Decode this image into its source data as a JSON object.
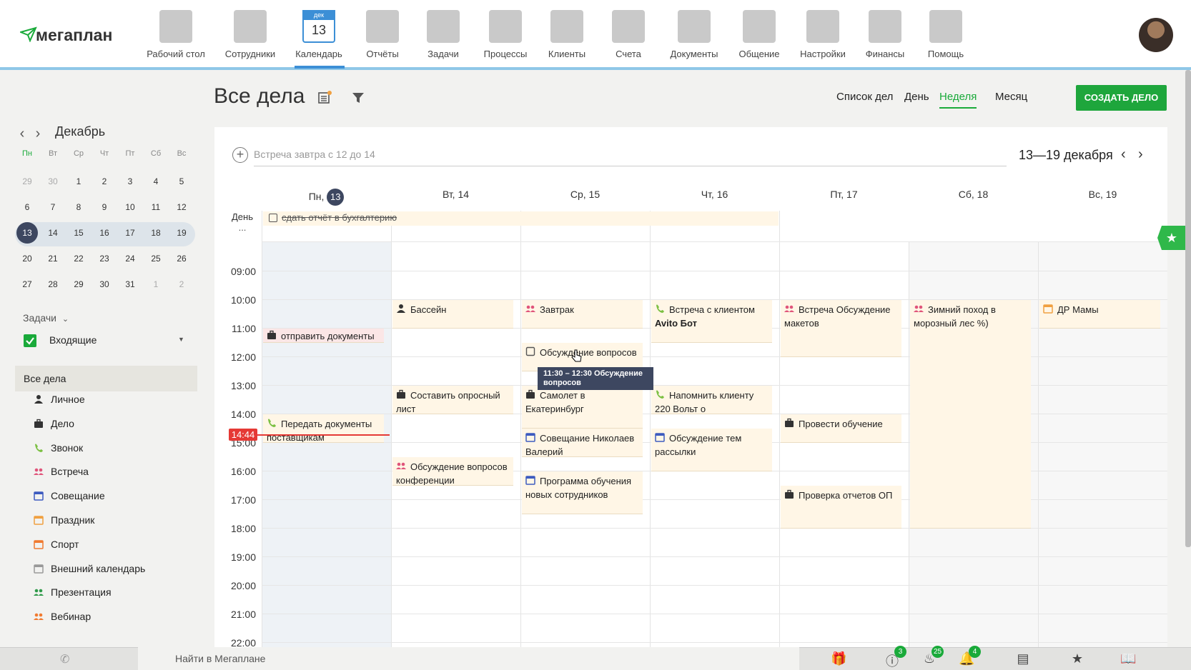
{
  "app": {
    "logo": "мегаплан"
  },
  "nav": [
    {
      "label": "Рабочий стол",
      "icon": "desktop-icon"
    },
    {
      "label": "Сотрудники",
      "icon": "employees-icon"
    },
    {
      "label": "Календарь",
      "icon": "calendar-icon",
      "active": true,
      "cal_month": "дек",
      "cal_day": "13"
    },
    {
      "label": "Отчёты",
      "icon": "reports-icon"
    },
    {
      "label": "Задачи",
      "icon": "tasks-icon"
    },
    {
      "label": "Процессы",
      "icon": "processes-icon"
    },
    {
      "label": "Клиенты",
      "icon": "clients-icon"
    },
    {
      "label": "Счета",
      "icon": "invoices-icon"
    },
    {
      "label": "Документы",
      "icon": "documents-icon"
    },
    {
      "label": "Общение",
      "icon": "chat-icon"
    },
    {
      "label": "Настройки",
      "icon": "settings-icon"
    },
    {
      "label": "Финансы",
      "icon": "finance-icon"
    },
    {
      "label": "Помощь",
      "icon": "help-icon"
    }
  ],
  "mini_calendar": {
    "month": "Декабрь",
    "weekdays": [
      "Пн",
      "Вт",
      "Ср",
      "Чт",
      "Пт",
      "Сб",
      "Вс"
    ],
    "weeks": [
      [
        "29",
        "30",
        "1",
        "2",
        "3",
        "4",
        "5"
      ],
      [
        "6",
        "7",
        "8",
        "9",
        "10",
        "11",
        "12"
      ],
      [
        "13",
        "14",
        "15",
        "16",
        "17",
        "18",
        "19"
      ],
      [
        "20",
        "21",
        "22",
        "23",
        "24",
        "25",
        "26"
      ],
      [
        "27",
        "28",
        "29",
        "30",
        "31",
        "1",
        "2"
      ]
    ],
    "selected": "13"
  },
  "sidebar": {
    "tasks_label": "Задачи",
    "incoming_label": "Входящие",
    "all_items": "Все дела",
    "categories": [
      {
        "label": "Личное",
        "icon": "person-icon",
        "color": "#333333"
      },
      {
        "label": "Дело",
        "icon": "briefcase-icon",
        "color": "#333333"
      },
      {
        "label": "Звонок",
        "icon": "phone-icon",
        "color": "#7cc043"
      },
      {
        "label": "Встреча",
        "icon": "meeting-icon",
        "color": "#e0547a"
      },
      {
        "label": "Совещание",
        "icon": "conference-icon",
        "color": "#3d5bbf"
      },
      {
        "label": "Праздник",
        "icon": "holiday-icon",
        "color": "#f0a040"
      },
      {
        "label": "Спорт",
        "icon": "sport-icon",
        "color": "#f07a30"
      },
      {
        "label": "Внешний календарь",
        "icon": "external-calendar-icon",
        "color": "#999999"
      },
      {
        "label": "Презентация",
        "icon": "presentation-icon",
        "color": "#2f9a4a"
      },
      {
        "label": "Вебинар",
        "icon": "webinar-icon",
        "color": "#f07a30"
      }
    ]
  },
  "header": {
    "title": "Все дела",
    "views": [
      "Список дел",
      "День",
      "Неделя",
      "Месяц"
    ],
    "active_view": "Неделя",
    "create_button": "СОЗДАТЬ ДЕЛО"
  },
  "quick_add": {
    "placeholder": "Встреча завтра с 12 до 14"
  },
  "week": {
    "range": "13—19 декабря",
    "days": [
      {
        "label": "Пн,",
        "num": "13",
        "today": true
      },
      {
        "label": "Вт, 14"
      },
      {
        "label": "Ср, 15"
      },
      {
        "label": "Чт, 16"
      },
      {
        "label": "Пт, 17"
      },
      {
        "label": "Сб, 18"
      },
      {
        "label": "Вс, 19"
      }
    ],
    "allday_label": "День",
    "allday_more": "...",
    "allday_event": "сдать отчёт в бухгалтерию",
    "hours": [
      "09:00",
      "10:00",
      "11:00",
      "12:00",
      "13:00",
      "14:00",
      "15:00",
      "16:00",
      "17:00",
      "18:00",
      "19:00",
      "20:00",
      "21:00",
      "22:00"
    ],
    "now": "14:44"
  },
  "events": [
    {
      "day": 0,
      "title": "отправить документы",
      "icon": "briefcase-icon",
      "color": "#333333",
      "start": "11:00",
      "end": "11:30",
      "style": "pink"
    },
    {
      "day": 0,
      "title": "Передать документы поставщикам",
      "icon": "phone-icon",
      "color": "#7cc043",
      "start": "14:00",
      "end": "15:00"
    },
    {
      "day": 1,
      "title": "Бассейн",
      "icon": "person-icon",
      "color": "#333333",
      "start": "10:00",
      "end": "11:00"
    },
    {
      "day": 1,
      "title": "Составить опросный лист",
      "icon": "briefcase-icon",
      "color": "#333333",
      "start": "13:00",
      "end": "14:00"
    },
    {
      "day": 1,
      "title": "Обсуждение вопросов конференции",
      "icon": "meeting-icon",
      "color": "#e0547a",
      "start": "15:30",
      "end": "16:30"
    },
    {
      "day": 2,
      "title": "Завтрак",
      "icon": "meeting-icon",
      "color": "#e0547a",
      "start": "10:00",
      "end": "11:00"
    },
    {
      "day": 2,
      "title": "Обсуждение вопросов",
      "icon": "checkbox-icon",
      "color": "#555555",
      "start": "11:30",
      "end": "12:30"
    },
    {
      "day": 2,
      "title": "Самолет в Екатеринбург",
      "icon": "briefcase-icon",
      "color": "#333333",
      "start": "13:00",
      "end": "14:30"
    },
    {
      "day": 2,
      "title": "Совещание Николаев Валерий",
      "icon": "conference-icon",
      "color": "#3d5bbf",
      "start": "14:30",
      "end": "15:30"
    },
    {
      "day": 2,
      "title": "Программа обучения новых сотрудников",
      "icon": "conference-icon",
      "color": "#3d5bbf",
      "start": "16:00",
      "end": "17:30"
    },
    {
      "day": 3,
      "title": "Встреча с клиентом ",
      "bold": "Avito Бот",
      "icon": "phone-icon",
      "color": "#7cc043",
      "start": "10:00",
      "end": "11:30"
    },
    {
      "day": 3,
      "title": "Напомнить клиенту 220 Вольт о",
      "icon": "phone-icon",
      "color": "#7cc043",
      "start": "13:00",
      "end": "14:00"
    },
    {
      "day": 3,
      "title": "Обсуждение тем рассылки",
      "icon": "conference-icon",
      "color": "#3d5bbf",
      "start": "14:30",
      "end": "16:00"
    },
    {
      "day": 4,
      "title": "Встреча  Обсуждение макетов",
      "icon": "meeting-icon",
      "color": "#e0547a",
      "start": "10:00",
      "end": "12:00"
    },
    {
      "day": 4,
      "title": "Провести обучение",
      "icon": "briefcase-icon",
      "color": "#333333",
      "start": "14:00",
      "end": "15:00"
    },
    {
      "day": 4,
      "title": "Проверка отчетов ОП",
      "icon": "briefcase-icon",
      "color": "#333333",
      "start": "16:30",
      "end": "18:00"
    },
    {
      "day": 5,
      "title": "Зимний поход в морозный лес %)",
      "icon": "meeting-icon",
      "color": "#e0547a",
      "start": "10:00",
      "end": "18:00"
    },
    {
      "day": 6,
      "title": "ДР Мамы",
      "icon": "holiday-icon",
      "color": "#f0a040",
      "start": "10:00",
      "end": "11:00"
    }
  ],
  "tooltip": {
    "text": "11:30 – 12:30 Обсуждение вопросов"
  },
  "bottom": {
    "search_placeholder": "Найти в Мегаплане",
    "badges": {
      "alerts": "3",
      "fire": "25",
      "bell": "4"
    }
  }
}
